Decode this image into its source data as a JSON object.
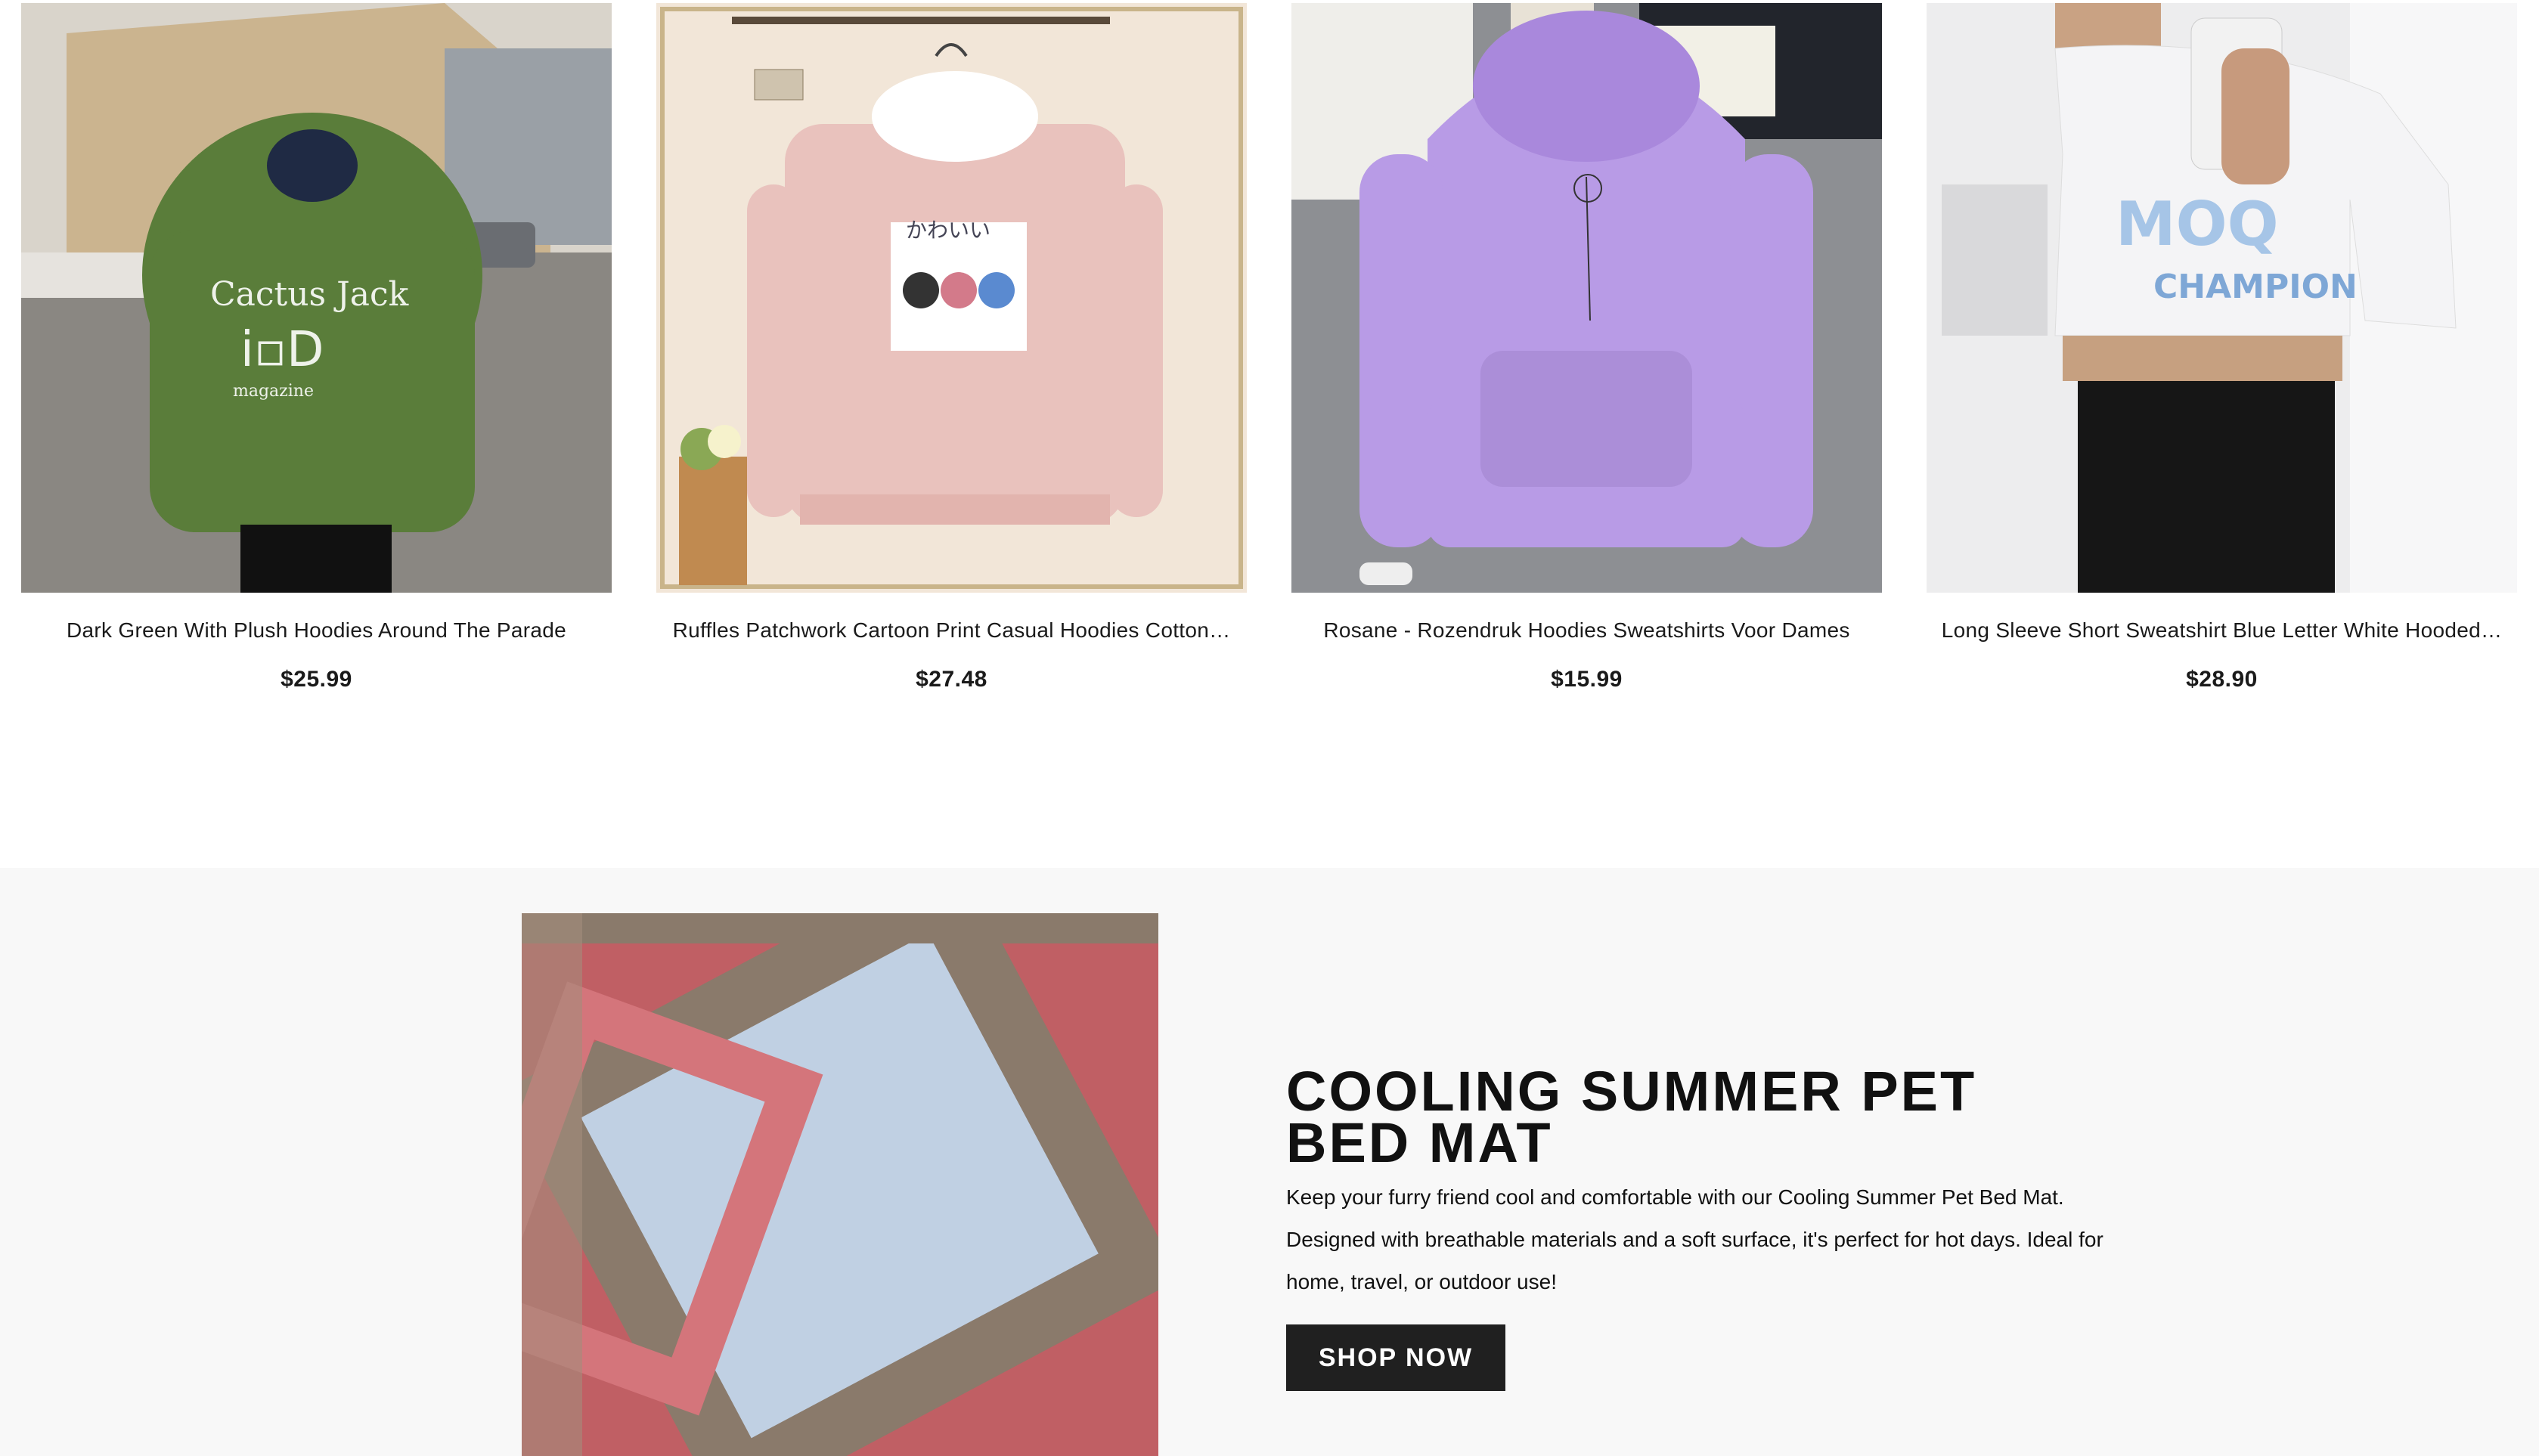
{
  "products": [
    {
      "title": "Dark Green With Plush Hoodies Around The Parade",
      "price": "$25.99",
      "print_text": "Cactus Jack"
    },
    {
      "title": "Ruffles Patchwork Cartoon Print Casual Hoodies Cotton…",
      "price": "$27.48",
      "print_text": "かわいい"
    },
    {
      "title": "Rosane - Rozendruk Hoodies Sweatshirts Voor Dames",
      "price": "$15.99"
    },
    {
      "title": "Long Sleeve Short Sweatshirt Blue Letter White Hooded…",
      "price": "$28.90",
      "print_text": "CHAMPION"
    }
  ],
  "promo": {
    "heading": "COOLING SUMMER PET BED MAT",
    "description": "Keep your furry friend cool and comfortable with our Cooling Summer Pet Bed Mat. Designed with breathable materials and a soft surface, it's perfect for hot days. Ideal for home, travel, or outdoor use!",
    "button_label": "SHOP NOW"
  },
  "colors": {
    "button_bg": "#202020",
    "promo_bg": "#f8f8f8",
    "hoodie_green": "#5a7d3a",
    "hoodie_pink": "#e9c2bd",
    "hoodie_purple": "#b89be6",
    "hoodie_white": "#f4f4f6"
  }
}
